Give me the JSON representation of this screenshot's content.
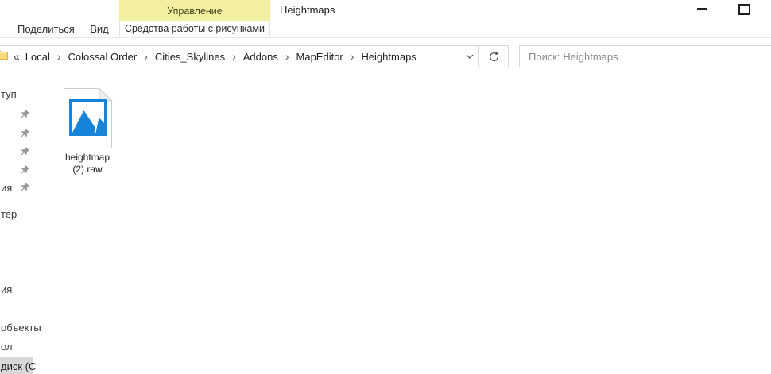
{
  "titlebar": {
    "contextual_group_label": "Управление",
    "window_title": "Heightmaps"
  },
  "ribbon_tabs": {
    "share": "Поделиться",
    "view": "Вид",
    "contextual": "Средства работы с рисунками"
  },
  "address_bar": {
    "overflow_indicator": "«",
    "breadcrumb": [
      "Local",
      "Colossal Order",
      "Cities_Skylines",
      "Addons",
      "MapEditor",
      "Heightmaps"
    ],
    "separator": "›"
  },
  "search_box": {
    "placeholder": "Поиск: Heightmaps"
  },
  "sidebar": {
    "items": [
      {
        "label": "туп",
        "pinned": false
      },
      {
        "label": "",
        "pinned": true
      },
      {
        "label": "",
        "pinned": true
      },
      {
        "label": "",
        "pinned": true
      },
      {
        "label": "",
        "pinned": true
      },
      {
        "label": "ия",
        "pinned": true
      },
      {
        "label": "тер",
        "pinned": false
      },
      {
        "label": "ия",
        "pinned": false
      },
      {
        "label": "объекты",
        "pinned": false
      },
      {
        "label": "ол",
        "pinned": false
      },
      {
        "label": "диск (С",
        "pinned": false,
        "selected": true
      }
    ]
  },
  "files": [
    {
      "name_line1": "heightmap",
      "name_line2": "(2).raw",
      "icon": "image-file-icon"
    }
  ],
  "colors": {
    "contextual_tab_bg": "#f3efa0",
    "file_icon_blue": "#1884d9",
    "selection_bg": "#d9d9d9"
  }
}
